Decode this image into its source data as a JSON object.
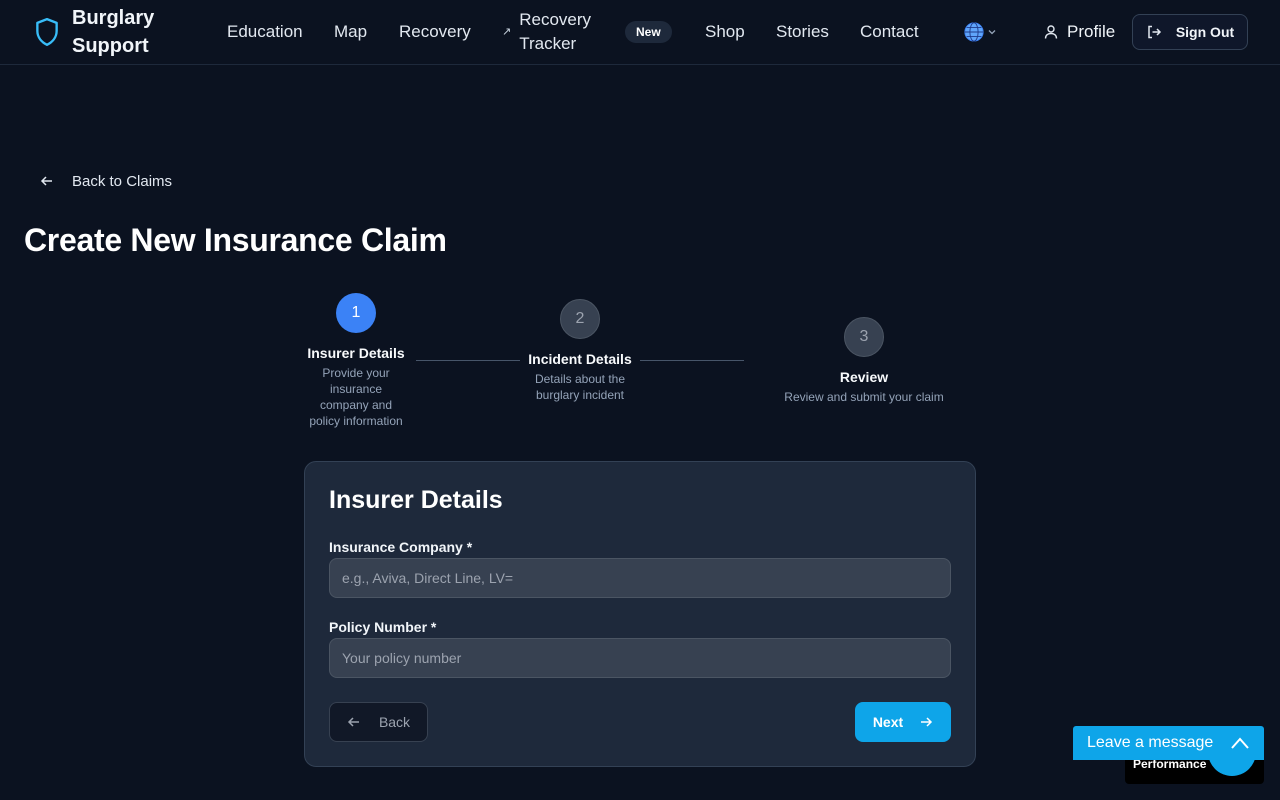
{
  "header": {
    "brand": "Burglary Support",
    "nav": {
      "education": "Education",
      "map": "Map",
      "recovery": "Recovery",
      "recovery_tracker_line1": "Recovery",
      "recovery_tracker_line2": "Tracker",
      "new_badge": "New",
      "shop": "Shop",
      "stories": "Stories",
      "contact": "Contact"
    },
    "language_icon": "globe-icon",
    "profile": "Profile",
    "sign_out": "Sign Out"
  },
  "back_link": "Back to Claims",
  "page_title": "Create New Insurance Claim",
  "stepper": {
    "steps": [
      {
        "number": "1",
        "title": "Insurer Details",
        "description": "Provide your insurance company and policy information",
        "state": "active"
      },
      {
        "number": "2",
        "title": "Incident Details",
        "description": "Details about the burglary incident",
        "state": "inactive"
      },
      {
        "number": "3",
        "title": "Review",
        "description": "Review and submit your claim",
        "state": "inactive"
      }
    ]
  },
  "form": {
    "title": "Insurer Details",
    "insurance_company": {
      "label": "Insurance Company *",
      "value": "",
      "placeholder": "e.g., Aviva, Direct Line, LV="
    },
    "policy_number": {
      "label": "Policy Number *",
      "value": "",
      "placeholder": "Your policy number"
    },
    "back_button": "Back",
    "next_button": "Next"
  },
  "widgets": {
    "chat_label": "Leave a message",
    "performance_label": "Performance"
  },
  "colors": {
    "background": "#0b1220",
    "card": "#1e293b",
    "accent": "#0ea5e9",
    "step_active": "#3b82f6"
  }
}
